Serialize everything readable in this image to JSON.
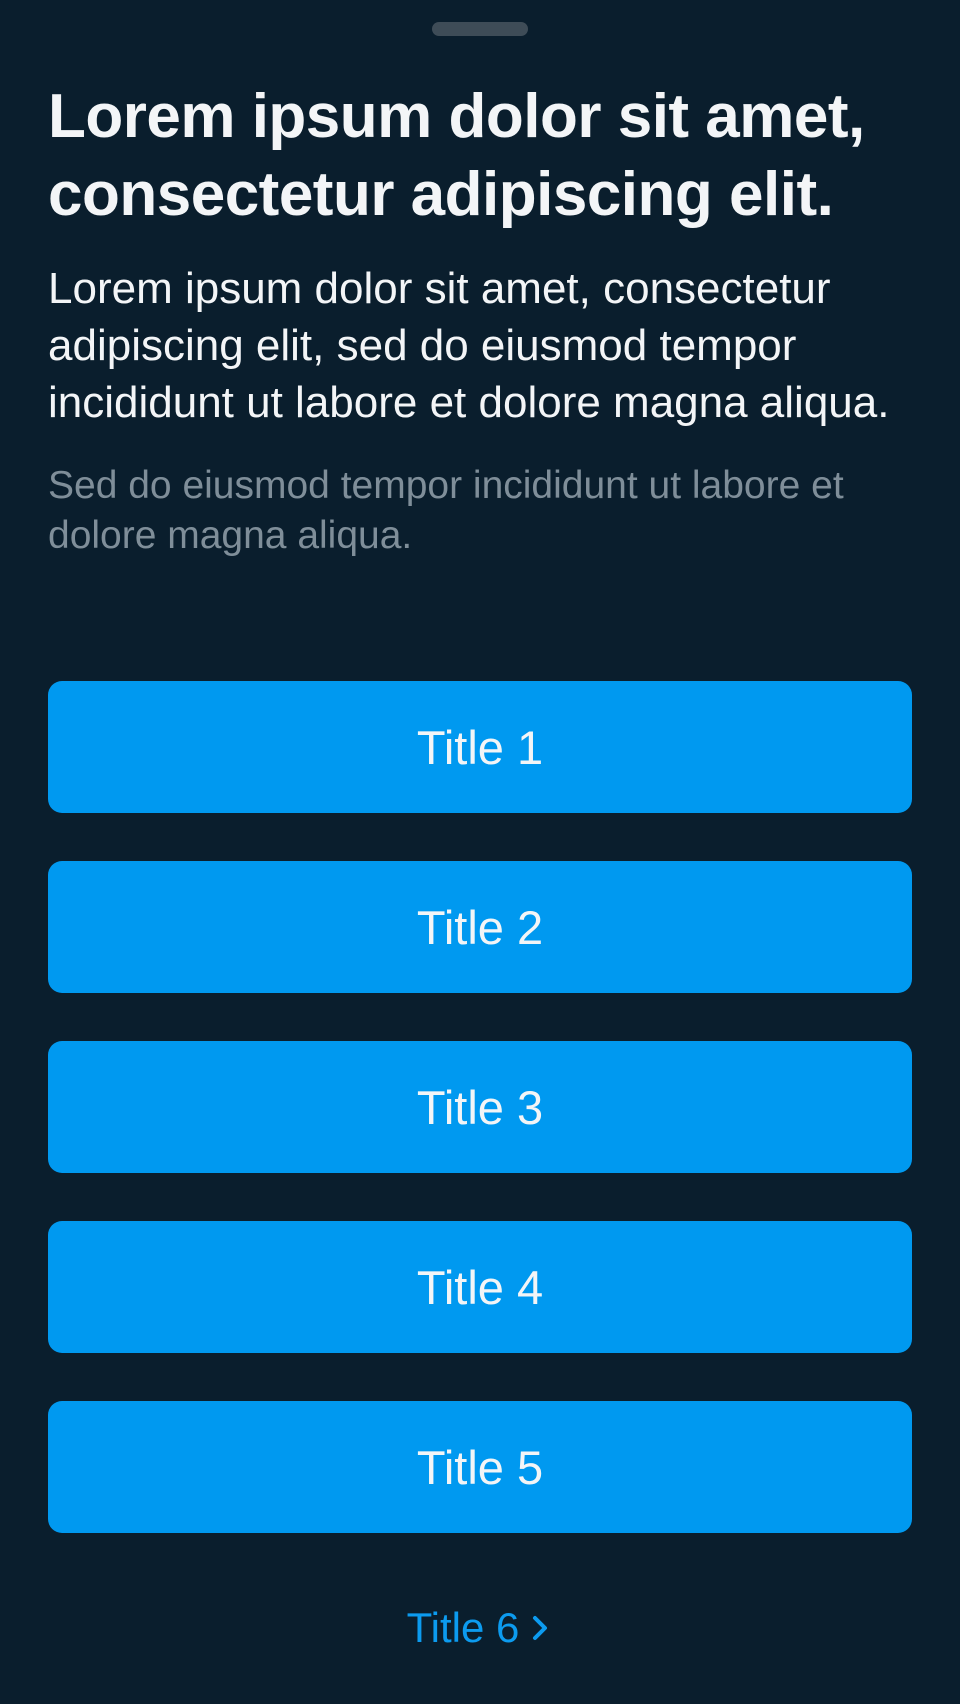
{
  "sheet": {
    "headline": "Lorem ipsum dolor sit amet, consectetur adipiscing elit.",
    "body": "Lorem ipsum dolor sit amet, consectetur adipiscing elit, sed do eiusmod tempor incididunt ut labore et dolore magna aliqua.",
    "caption": "Sed do eiusmod tempor incididunt ut labore et dolore magna aliqua."
  },
  "actions": [
    {
      "label": "Title 1"
    },
    {
      "label": "Title 2"
    },
    {
      "label": "Title 3"
    },
    {
      "label": "Title 4"
    },
    {
      "label": "Title 5"
    }
  ],
  "link": {
    "label": "Title 6",
    "icon": "chevron-right-icon"
  },
  "colors": {
    "background": "#0A1E2D",
    "button": "#0099F0",
    "link": "#0C9BEF",
    "caption": "#7F8E99",
    "grabber": "#3E4C57"
  }
}
